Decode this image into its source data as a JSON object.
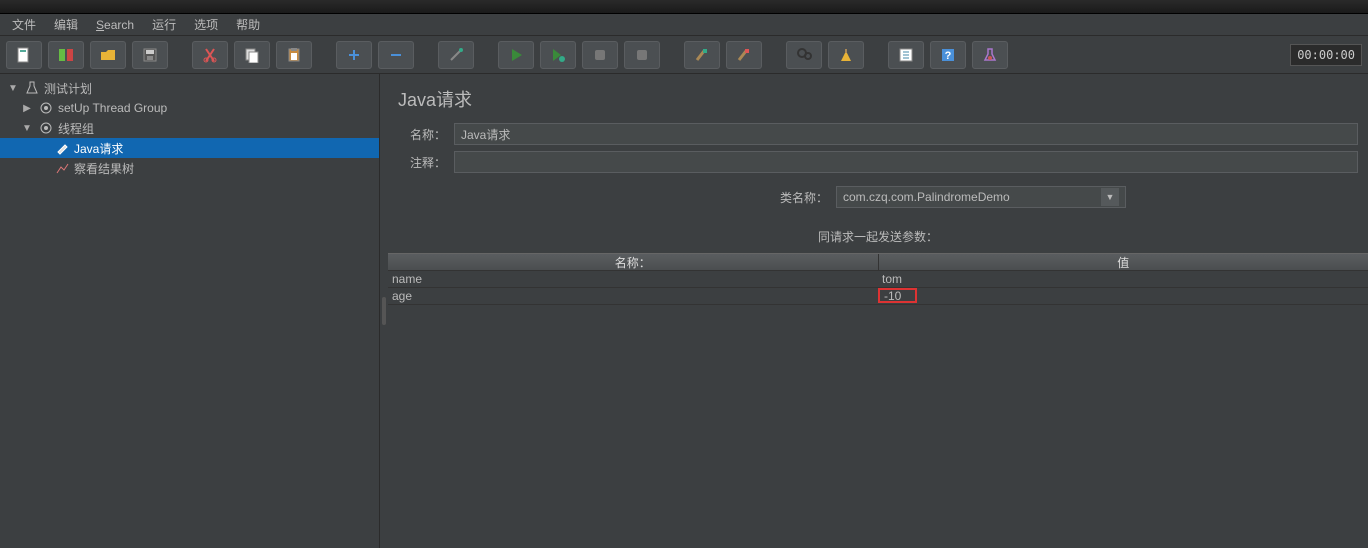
{
  "menubar": {
    "items": [
      "文件",
      "编辑",
      "Search",
      "运行",
      "选项",
      "帮助"
    ]
  },
  "toolbar": {
    "timer": "00:00:00"
  },
  "tree": {
    "root": {
      "label": "测试计划"
    },
    "nodes": [
      {
        "label": "setUp Thread Group",
        "expanded": false
      },
      {
        "label": "线程组",
        "expanded": true,
        "children": [
          {
            "label": "Java请求",
            "selected": true
          },
          {
            "label": "察看结果树"
          }
        ]
      }
    ]
  },
  "content": {
    "title": "Java请求",
    "name_label": "名称：",
    "name_value": "Java请求",
    "comment_label": "注释：",
    "comment_value": "",
    "classname_label": "类名称：",
    "classname_value": "com.czq.com.PalindromeDemo",
    "params_caption": "同请求一起发送参数：",
    "table": {
      "headers": [
        "名称：",
        "值"
      ],
      "rows": [
        {
          "name": "name",
          "value": "tom",
          "highlight": false
        },
        {
          "name": "age",
          "value": "-10",
          "highlight": true
        }
      ]
    }
  }
}
